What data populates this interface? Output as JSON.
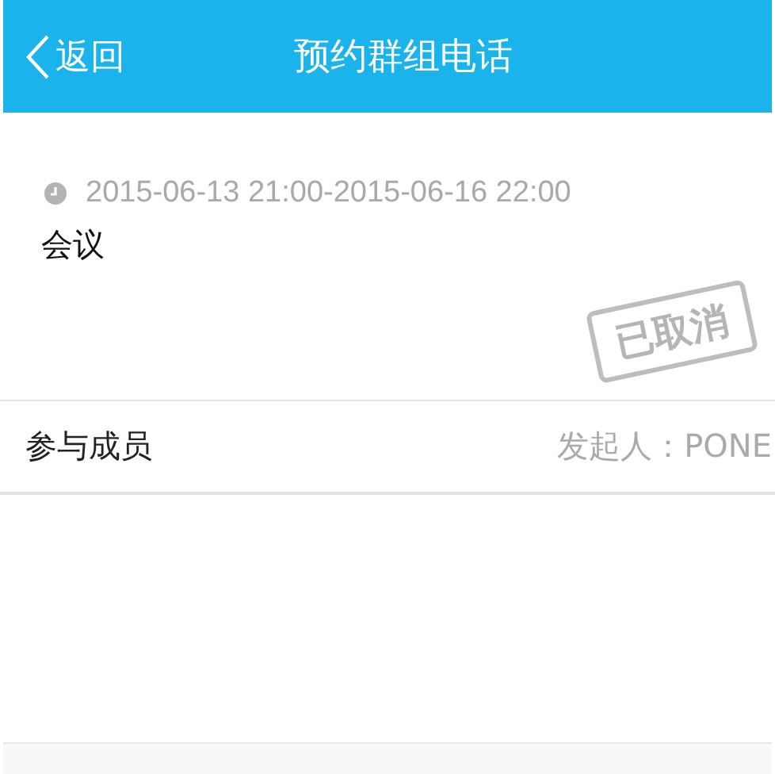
{
  "nav_bar": {
    "back": "返回",
    "title": "预约群组电话"
  },
  "meeting": {
    "time": "2015-06-13 21:00-2015-06-16 22:00",
    "subject": "会议",
    "stamp": "已取消"
  },
  "members": {
    "label": "参与成员",
    "initiator": "发起人：PONE"
  }
}
